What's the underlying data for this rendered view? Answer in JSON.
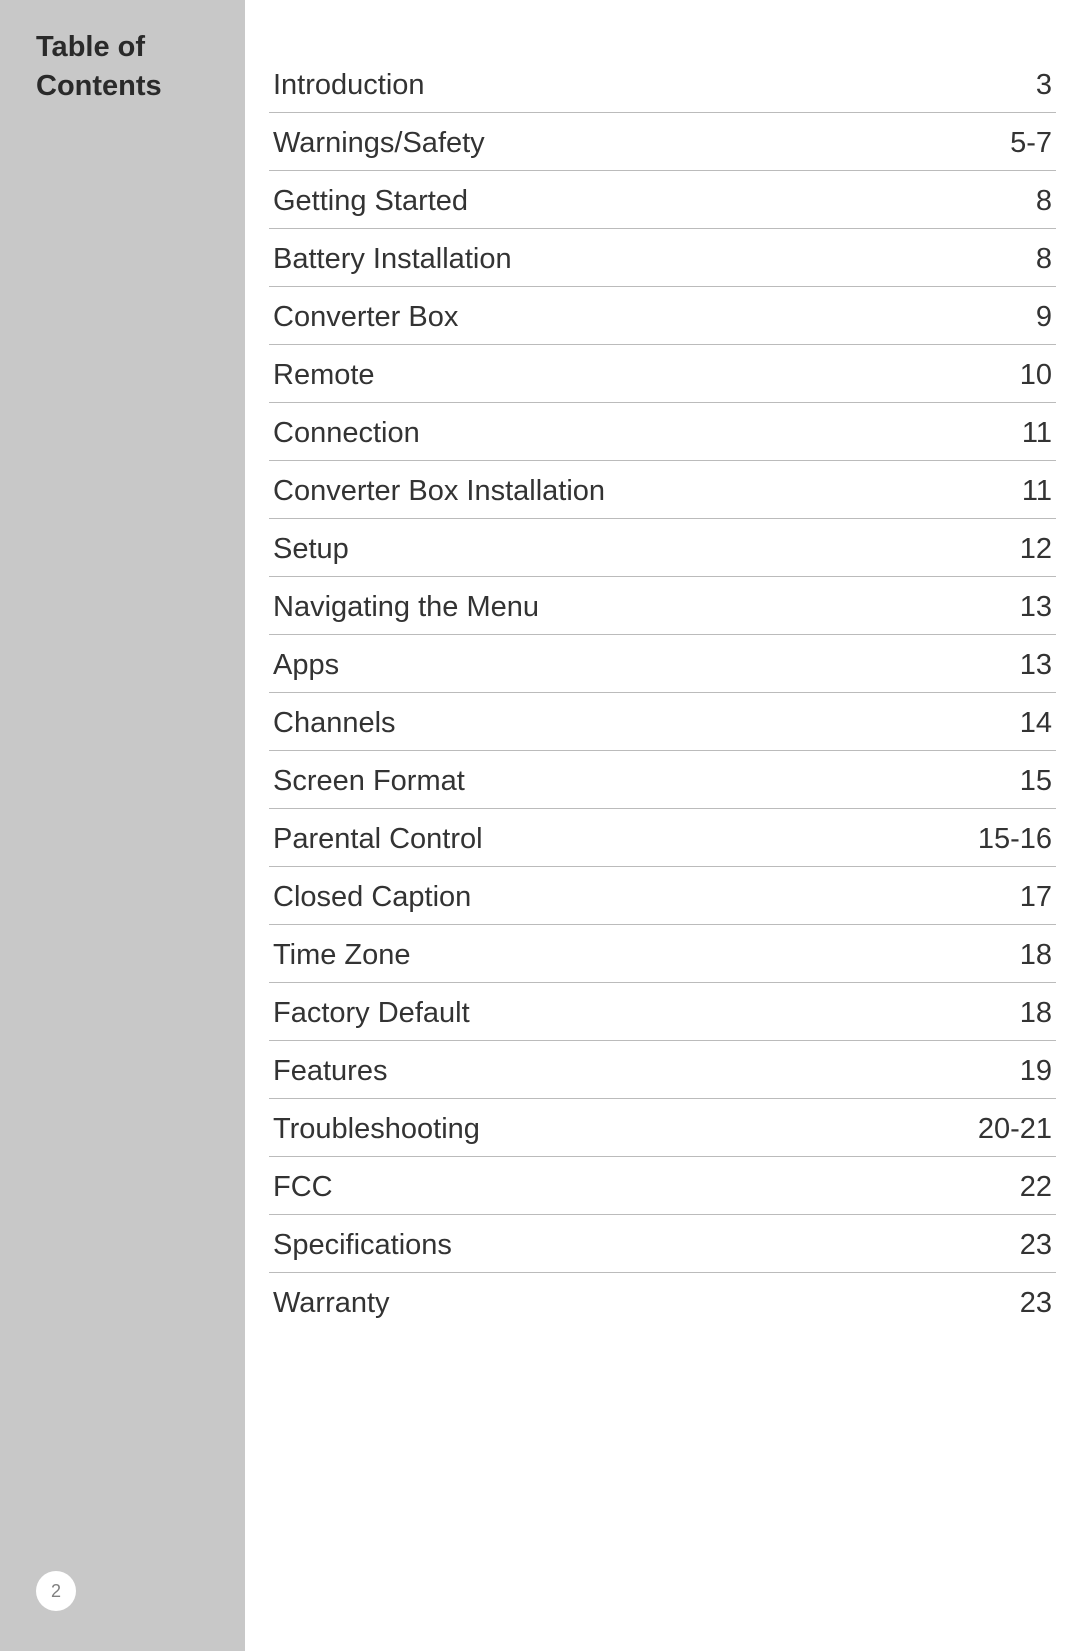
{
  "sidebar": {
    "title_line1": "Table of",
    "title_line2": "Contents"
  },
  "page_number": "2",
  "toc": [
    {
      "label": "Introduction",
      "page": "3"
    },
    {
      "label": "Warnings/Safety",
      "page": "5-7"
    },
    {
      "label": "Getting Started",
      "page": "8"
    },
    {
      "label": "Battery Installation",
      "page": "8"
    },
    {
      "label": "Converter Box",
      "page": "9"
    },
    {
      "label": "Remote",
      "page": "10"
    },
    {
      "label": "Connection",
      "page": "11"
    },
    {
      "label": "Converter Box Installation",
      "page": "11"
    },
    {
      "label": "Setup",
      "page": "12"
    },
    {
      "label": "Navigating the Menu",
      "page": "13"
    },
    {
      "label": "Apps",
      "page": "13"
    },
    {
      "label": "Channels",
      "page": "14"
    },
    {
      "label": "Screen Format",
      "page": "15"
    },
    {
      "label": "Parental Control",
      "page": "15-16"
    },
    {
      "label": "Closed Caption",
      "page": "17"
    },
    {
      "label": "Time Zone",
      "page": "18"
    },
    {
      "label": "Factory Default",
      "page": "18"
    },
    {
      "label": "Features",
      "page": "19"
    },
    {
      "label": "Troubleshooting",
      "page": "20-21"
    },
    {
      "label": "FCC",
      "page": "22"
    },
    {
      "label": "Specifications",
      "page": "23"
    },
    {
      "label": "Warranty",
      "page": "23"
    }
  ]
}
